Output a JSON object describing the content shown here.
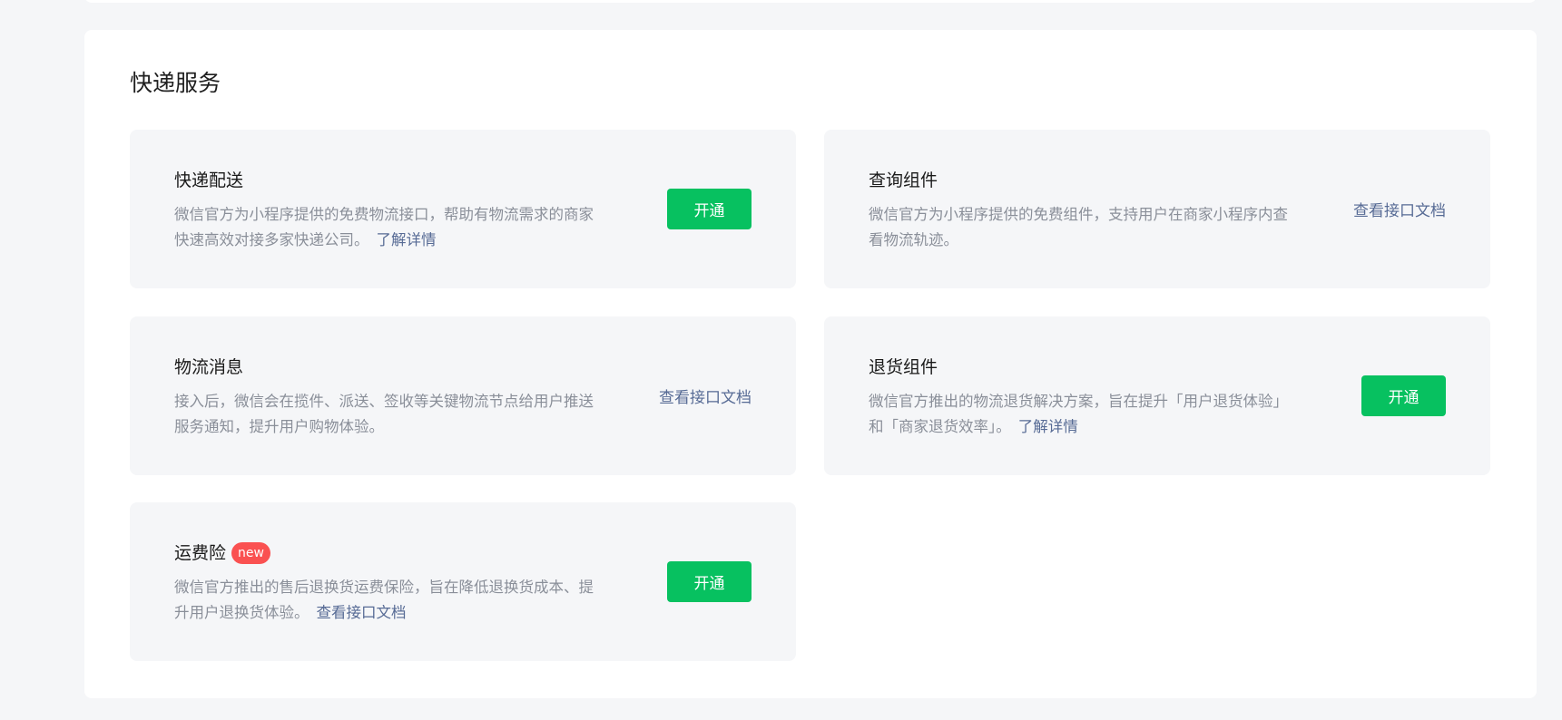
{
  "section": {
    "title": "快递服务"
  },
  "cards": [
    {
      "title": "快递配送",
      "desc": "微信官方为小程序提供的免费物流接口，帮助有物流需求的商家快速高效对接多家快递公司。",
      "inline_link": "了解详情",
      "action": "开通"
    },
    {
      "title": "查询组件",
      "desc": "微信官方为小程序提供的免费组件，支持用户在商家小程序内查看物流轨迹。",
      "action": "查看接口文档"
    },
    {
      "title": "物流消息",
      "desc": "接入后，微信会在揽件、派送、签收等关键物流节点给用户推送服务通知，提升用户购物体验。",
      "action": "查看接口文档"
    },
    {
      "title": "退货组件",
      "desc": "微信官方推出的物流退货解决方案，旨在提升「用户退货体验」和「商家退货效率」。",
      "inline_link": "了解详情",
      "action": "开通"
    },
    {
      "title": "运费险",
      "badge": "new",
      "desc": "微信官方推出的售后退换货运费保险，旨在降低退换货成本、提升用户退换货体验。",
      "inline_link": "查看接口文档",
      "action": "开通"
    }
  ],
  "colors": {
    "primary_button": "#07c160",
    "link": "#576b95",
    "badge": "#fa5151",
    "card_bg": "#f5f6f8"
  }
}
